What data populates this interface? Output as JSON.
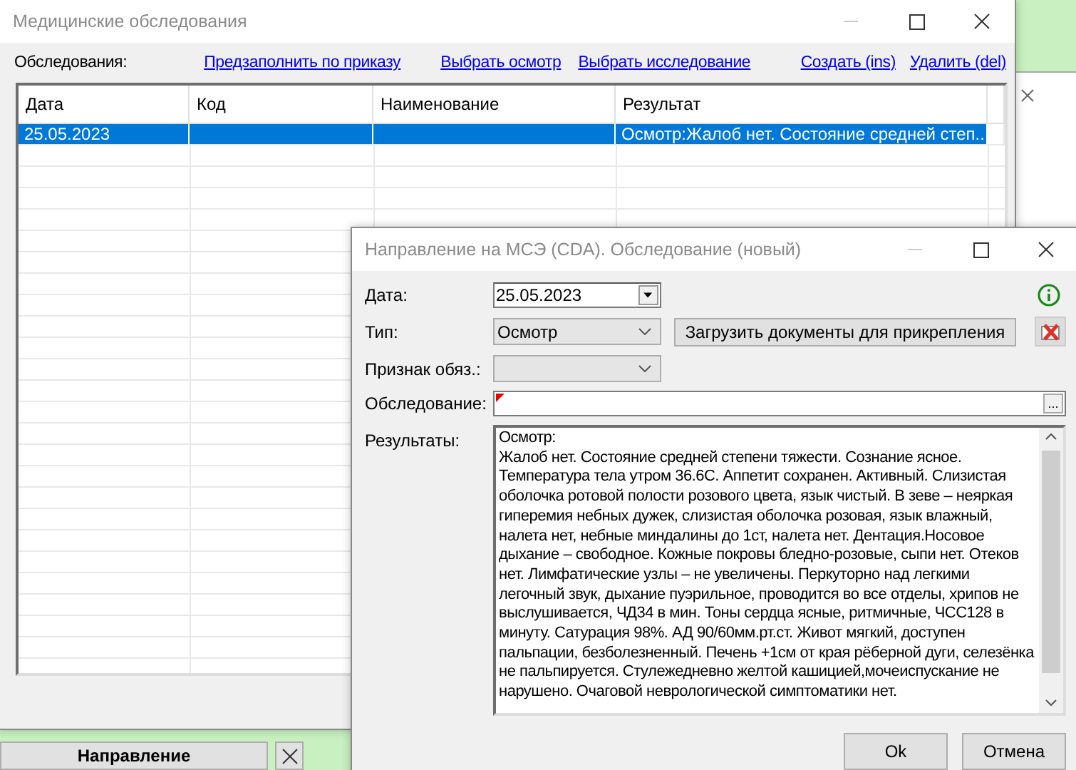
{
  "main_window": {
    "title": "Медицинские обследования",
    "label": "Обследования:",
    "links": [
      "Предзаполнить по приказу",
      "Выбрать осмотр",
      "Выбрать исследование",
      "Создать (ins)",
      "Удалить (del)"
    ],
    "table": {
      "columns": [
        "Дата",
        "Код",
        "Наименование",
        "Результат"
      ],
      "rows": [
        {
          "cells": [
            "25.05.2023",
            "",
            "",
            "Осмотр:Жалоб нет. Состояние средней степ..."
          ],
          "selected": true
        }
      ]
    }
  },
  "taskbar": {
    "button": "Направление"
  },
  "dialog": {
    "title": "Направление на МСЭ (CDA). Обследование (новый)",
    "fields": [
      {
        "kind": "date",
        "label": "Дата:",
        "value": "25.05.2023"
      },
      {
        "kind": "select",
        "label": "Тип:",
        "value": "Осмотр"
      },
      {
        "kind": "select",
        "label": "Признак обяз.:"
      },
      {
        "kind": "lookup",
        "label": "Обследование:",
        "required": true,
        "browse_button": "..."
      }
    ],
    "upload_button": "Загрузить документы для прикрепления",
    "results": {
      "label": "Результаты:",
      "text": "Осмотр:\nЖалоб нет. Состояние средней степени тяжести. Сознание ясное. Температура тела утром 36.6С. Аппетит сохранен. Активный. Слизистая оболочка ротовой полости розового цвета, язык чистый. В зеве – неяркая гиперемия небных дужек, слизистая оболочка розовая, язык влажный, налета нет, небные миндалины до 1ст, налета нет. Дентация.Носовое дыхание – свободное. Кожные покровы бледно-розовые, сыпи нет. Отеков нет. Лимфатические узлы – не увеличены. Перкуторно над легкими легочный звук, дыхание пуэрильное, проводится во все отделы, хрипов не выслушивается, ЧД34 в мин. Тоны сердца ясные, ритмичные, ЧСС128 в минуту. Сатурация 98%. АД 90/60мм.рт.ст. Живот мягкий, доступен пальпации, безболезненный. Печень +1см от края рёберной дуги, селезёнка не пальпируется. Стулежедневно желтой кашицией,мочеиспускание не нарушено. Очаговой неврологической симптоматики нет."
    },
    "buttons": [
      "Ok",
      "Отмена"
    ]
  }
}
